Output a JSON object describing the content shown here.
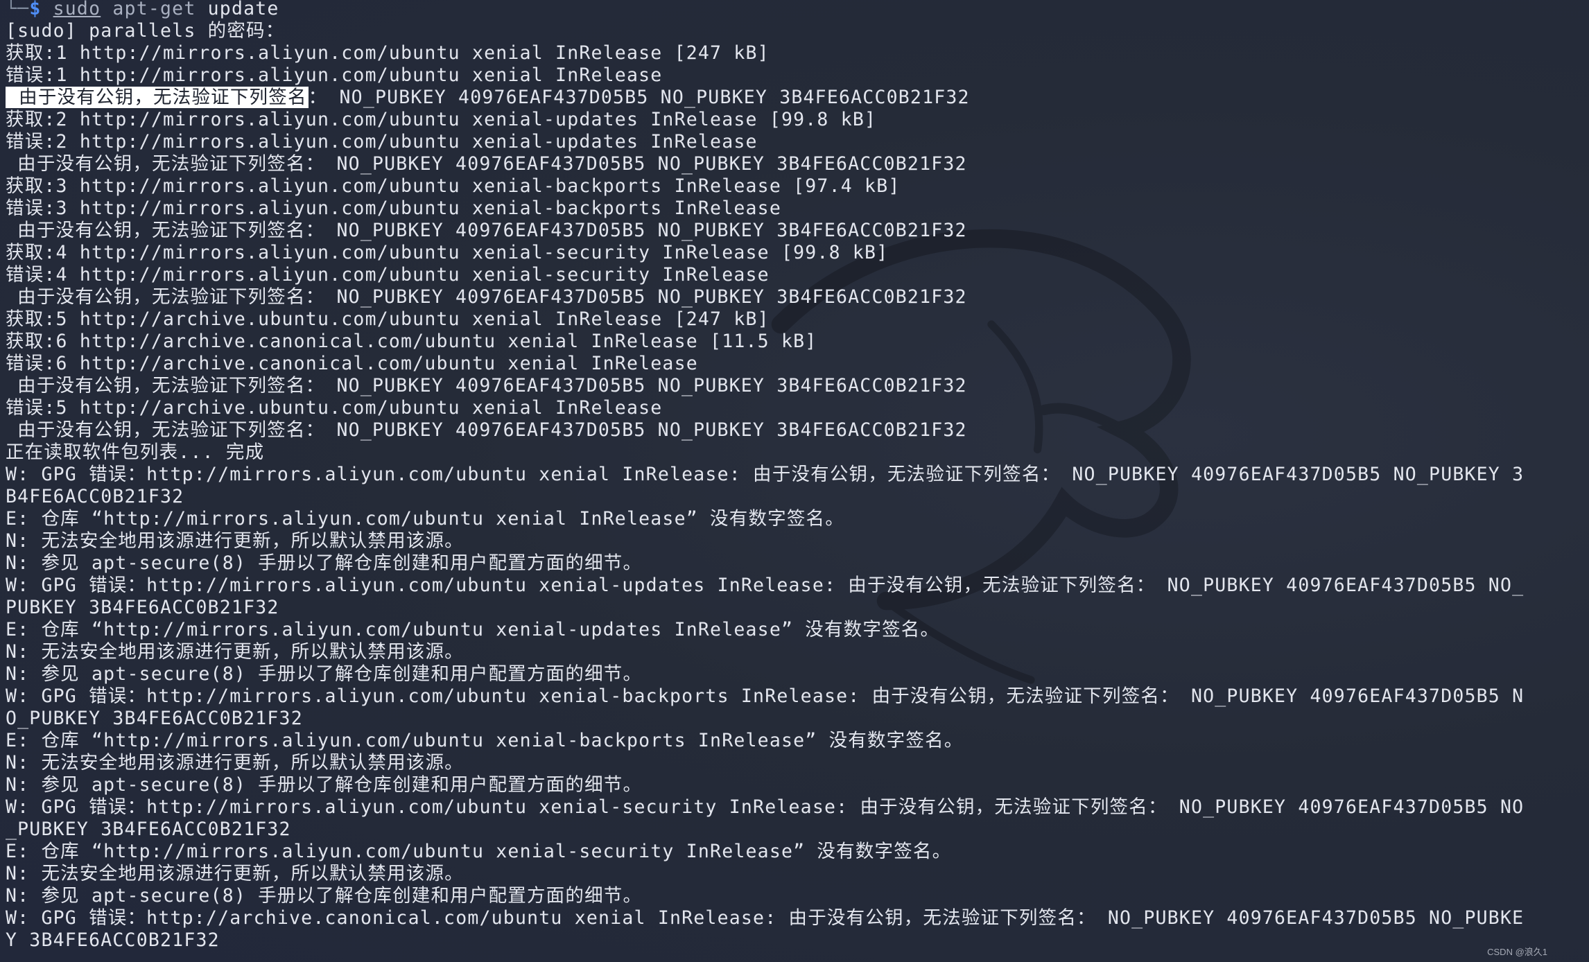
{
  "terminal": {
    "prompt": {
      "tree": "└─",
      "dollar": "$",
      "sudo": "sudo",
      "command": "apt-get",
      "arg": "update"
    },
    "highlight_text": " 由于没有公钥，无法验证下列签名",
    "lines": [
      "[sudo] parallels 的密码：",
      "获取:1 http://mirrors.aliyun.com/ubuntu xenial InRelease [247 kB]",
      "错误:1 http://mirrors.aliyun.com/ubuntu xenial InRelease",
      " 由于没有公钥，无法验证下列签名： NO_PUBKEY 40976EAF437D05B5 NO_PUBKEY 3B4FE6ACC0B21F32",
      "获取:2 http://mirrors.aliyun.com/ubuntu xenial-updates InRelease [99.8 kB]",
      "错误:2 http://mirrors.aliyun.com/ubuntu xenial-updates InRelease",
      " 由于没有公钥，无法验证下列签名： NO_PUBKEY 40976EAF437D05B5 NO_PUBKEY 3B4FE6ACC0B21F32",
      "获取:3 http://mirrors.aliyun.com/ubuntu xenial-backports InRelease [97.4 kB]",
      "错误:3 http://mirrors.aliyun.com/ubuntu xenial-backports InRelease",
      " 由于没有公钥，无法验证下列签名： NO_PUBKEY 40976EAF437D05B5 NO_PUBKEY 3B4FE6ACC0B21F32",
      "获取:4 http://mirrors.aliyun.com/ubuntu xenial-security InRelease [99.8 kB]",
      "错误:4 http://mirrors.aliyun.com/ubuntu xenial-security InRelease",
      " 由于没有公钥，无法验证下列签名： NO_PUBKEY 40976EAF437D05B5 NO_PUBKEY 3B4FE6ACC0B21F32",
      "获取:5 http://archive.ubuntu.com/ubuntu xenial InRelease [247 kB]",
      "获取:6 http://archive.canonical.com/ubuntu xenial InRelease [11.5 kB]",
      "错误:6 http://archive.canonical.com/ubuntu xenial InRelease",
      " 由于没有公钥，无法验证下列签名： NO_PUBKEY 40976EAF437D05B5 NO_PUBKEY 3B4FE6ACC0B21F32",
      "错误:5 http://archive.ubuntu.com/ubuntu xenial InRelease",
      " 由于没有公钥，无法验证下列签名： NO_PUBKEY 40976EAF437D05B5 NO_PUBKEY 3B4FE6ACC0B21F32",
      "正在读取软件包列表... 完成",
      "W: GPG 错误：http://mirrors.aliyun.com/ubuntu xenial InRelease: 由于没有公钥，无法验证下列签名： NO_PUBKEY 40976EAF437D05B5 NO_PUBKEY 3",
      "B4FE6ACC0B21F32",
      "E: 仓库 “http://mirrors.aliyun.com/ubuntu xenial InRelease” 没有数字签名。",
      "N: 无法安全地用该源进行更新，所以默认禁用该源。",
      "N: 参见 apt-secure(8) 手册以了解仓库创建和用户配置方面的细节。",
      "W: GPG 错误：http://mirrors.aliyun.com/ubuntu xenial-updates InRelease: 由于没有公钥，无法验证下列签名： NO_PUBKEY 40976EAF437D05B5 NO_",
      "PUBKEY 3B4FE6ACC0B21F32",
      "E: 仓库 “http://mirrors.aliyun.com/ubuntu xenial-updates InRelease” 没有数字签名。",
      "N: 无法安全地用该源进行更新，所以默认禁用该源。",
      "N: 参见 apt-secure(8) 手册以了解仓库创建和用户配置方面的细节。",
      "W: GPG 错误：http://mirrors.aliyun.com/ubuntu xenial-backports InRelease: 由于没有公钥，无法验证下列签名： NO_PUBKEY 40976EAF437D05B5 N",
      "O_PUBKEY 3B4FE6ACC0B21F32",
      "E: 仓库 “http://mirrors.aliyun.com/ubuntu xenial-backports InRelease” 没有数字签名。",
      "N: 无法安全地用该源进行更新，所以默认禁用该源。",
      "N: 参见 apt-secure(8) 手册以了解仓库创建和用户配置方面的细节。",
      "W: GPG 错误：http://mirrors.aliyun.com/ubuntu xenial-security InRelease: 由于没有公钥，无法验证下列签名： NO_PUBKEY 40976EAF437D05B5 NO",
      "_PUBKEY 3B4FE6ACC0B21F32",
      "E: 仓库 “http://mirrors.aliyun.com/ubuntu xenial-security InRelease” 没有数字签名。",
      "N: 无法安全地用该源进行更新，所以默认禁用该源。",
      "N: 参见 apt-secure(8) 手册以了解仓库创建和用户配置方面的细节。",
      "W: GPG 错误：http://archive.canonical.com/ubuntu xenial InRelease: 由于没有公钥，无法验证下列签名： NO_PUBKEY 40976EAF437D05B5 NO_PUBKE",
      "Y 3B4FE6ACC0B21F32"
    ]
  },
  "watermark": "CSDN @浪久1",
  "colors": {
    "background": "#242a37",
    "text": "#e3e6ee",
    "prompt_dollar": "#4f8ef7",
    "highlight_bg": "#ffffff"
  },
  "icons": {
    "wallpaper": "kali-dragon-icon"
  }
}
